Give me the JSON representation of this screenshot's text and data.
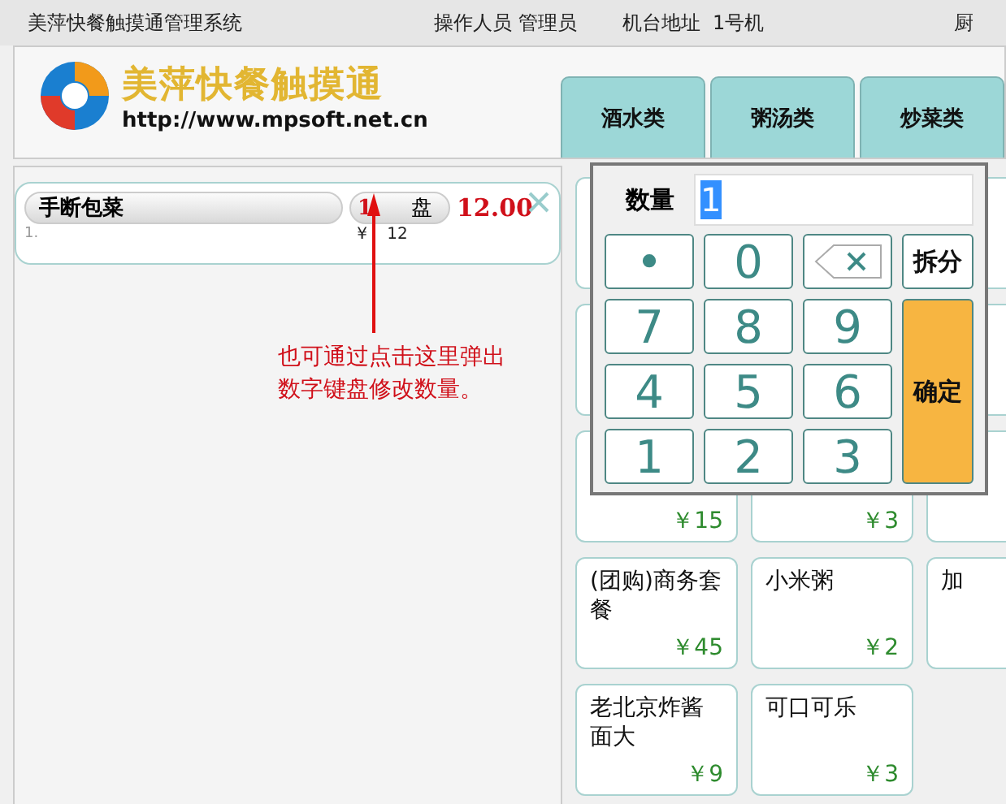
{
  "title_bar": {
    "app_name": "美萍快餐触摸通管理系统",
    "operator": "操作人员 管理员",
    "terminal": "机台地址  1号机",
    "column_4": "厨"
  },
  "logo": {
    "name": "美萍快餐触摸通",
    "url": "http://www.mpsoft.net.cn"
  },
  "tabs": [
    {
      "label": "酒水类",
      "selected": false
    },
    {
      "label": "粥汤类",
      "selected": false
    },
    {
      "label": "炒菜类",
      "selected": false
    }
  ],
  "order_items": [
    {
      "index": "1.",
      "name": "手断包菜",
      "quantity": "1",
      "unit": "盘",
      "total": "12.00",
      "price": "¥ 12"
    }
  ],
  "annotation": "也可通过点击这里弹出数字键盘修改数量。",
  "keypad": {
    "label": "数量",
    "value": "1",
    "side_buttons": [
      {
        "kind": "split",
        "label": "拆分"
      },
      {
        "kind": "confirm",
        "label": "确定"
      }
    ],
    "rows": [
      [
        {
          "kind": "key",
          "label": "•"
        },
        {
          "kind": "key",
          "label": "0"
        },
        {
          "kind": "backspace"
        }
      ],
      [
        {
          "kind": "key",
          "label": "7"
        },
        {
          "kind": "key",
          "label": "8"
        },
        {
          "kind": "key",
          "label": "9"
        }
      ],
      [
        {
          "kind": "key",
          "label": "4"
        },
        {
          "kind": "key",
          "label": "5"
        },
        {
          "kind": "key",
          "label": "6"
        }
      ],
      [
        {
          "kind": "key",
          "label": "1"
        },
        {
          "kind": "key",
          "label": "2"
        },
        {
          "kind": "key",
          "label": "3"
        }
      ]
    ]
  },
  "dishes": [
    {
      "kind": "covered"
    },
    {
      "kind": "spacer"
    },
    {
      "kind": "covered"
    },
    {
      "kind": "covered"
    },
    {
      "kind": "spacer"
    },
    {
      "kind": "covered"
    },
    {
      "kind": "dish",
      "price": "￥15"
    },
    {
      "kind": "dish",
      "price": "￥3"
    },
    {
      "kind": "covered"
    },
    {
      "kind": "dish",
      "name": "(团购)商务套餐",
      "price": "￥45"
    },
    {
      "kind": "dish",
      "name": "小米粥",
      "price": "￥2"
    },
    {
      "kind": "dish",
      "name": "加"
    },
    {
      "kind": "dish",
      "name": "老北京炸酱面大",
      "price": "￥9"
    },
    {
      "kind": "dish",
      "name": "可口可乐",
      "price": "￥3"
    }
  ]
}
